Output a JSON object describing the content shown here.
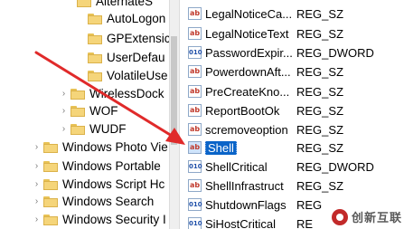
{
  "tree": {
    "items": [
      {
        "label": "AlternateS",
        "chevron": false
      },
      {
        "label": "AutoLogon",
        "chevron": false
      },
      {
        "label": "GPExtensic",
        "chevron": false
      },
      {
        "label": "UserDefau",
        "chevron": false
      },
      {
        "label": "VolatileUse",
        "chevron": false
      },
      {
        "label": "WirelessDock",
        "chevron": true
      },
      {
        "label": "WOF",
        "chevron": true
      },
      {
        "label": "WUDF",
        "chevron": true
      },
      {
        "label": "Windows Photo Vie",
        "chevron": true
      },
      {
        "label": "Windows Portable",
        "chevron": true
      },
      {
        "label": "Windows Script Hc",
        "chevron": true
      },
      {
        "label": "Windows Search",
        "chevron": true
      },
      {
        "label": "Windows Security I",
        "chevron": true
      }
    ]
  },
  "values": {
    "rows": [
      {
        "name": "LegalNoticeCa...",
        "type": "REG_SZ",
        "icon": "string-value-icon"
      },
      {
        "name": "LegalNoticeText",
        "type": "REG_SZ",
        "icon": "string-value-icon"
      },
      {
        "name": "PasswordExpir...",
        "type": "REG_DWORD",
        "icon": "dword-value-icon"
      },
      {
        "name": "PowerdownAft...",
        "type": "REG_SZ",
        "icon": "string-value-icon"
      },
      {
        "name": "PreCreateKno...",
        "type": "REG_SZ",
        "icon": "string-value-icon"
      },
      {
        "name": "ReportBootOk",
        "type": "REG_SZ",
        "icon": "string-value-icon"
      },
      {
        "name": "scremoveoption",
        "type": "REG_SZ",
        "icon": "string-value-icon"
      },
      {
        "name": "Shell",
        "type": "REG_SZ",
        "icon": "string-value-icon",
        "selected": true
      },
      {
        "name": "ShellCritical",
        "type": "REG_DWORD",
        "icon": "dword-value-icon"
      },
      {
        "name": "ShellInfrastruct",
        "type": "REG_SZ",
        "icon": "string-value-icon"
      },
      {
        "name": "ShutdownFlags",
        "type": "REG",
        "icon": "dword-value-icon"
      },
      {
        "name": "SiHostCritical",
        "type": "RE",
        "icon": "dword-value-icon"
      }
    ]
  },
  "icons": {
    "string": "ab",
    "dword": "010"
  },
  "watermark": {
    "text": "创新互联"
  },
  "colors": {
    "arrow": "#e02a2a",
    "selection": "#0a64c8",
    "folder": "#f5d57a"
  }
}
